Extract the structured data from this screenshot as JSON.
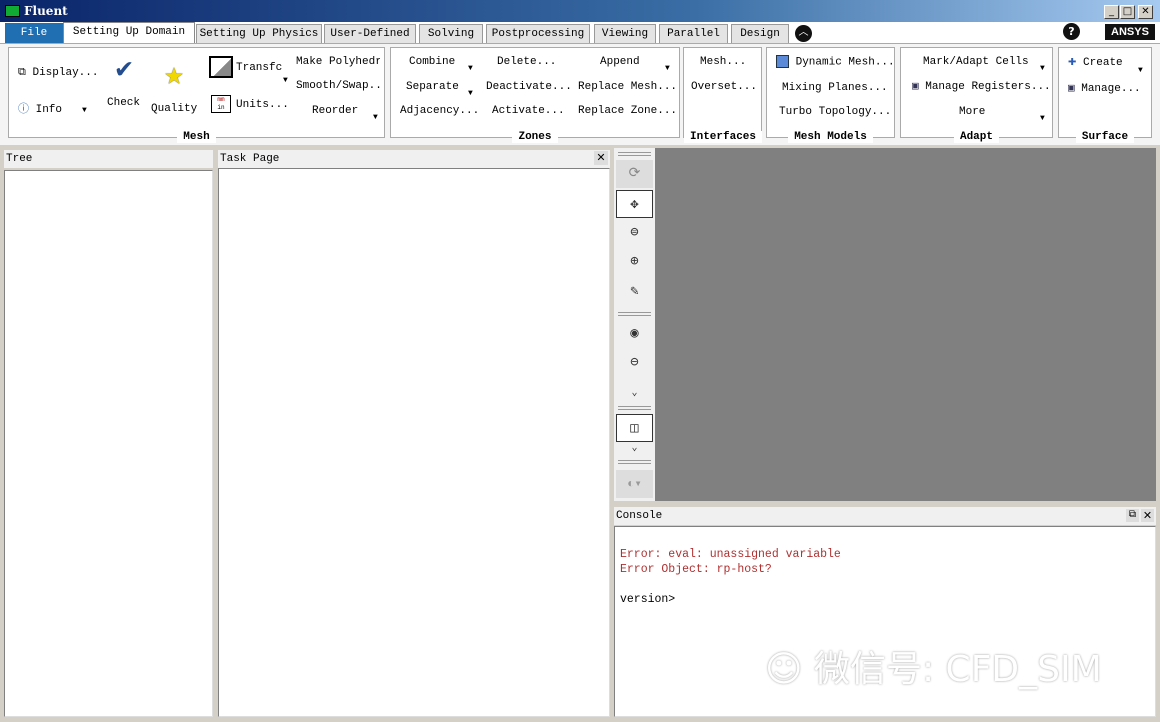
{
  "window": {
    "title": "Fluent",
    "min": "_",
    "max": "□",
    "close": "✕"
  },
  "tabs": [
    "File",
    "Setting Up Domain",
    "Setting Up Physics",
    "User-Defined",
    "Solving",
    "Postprocessing",
    "Viewing",
    "Parallel",
    "Design"
  ],
  "help": "?",
  "logo": "ANSYS",
  "ribbon": {
    "mesh": {
      "label": "Mesh",
      "display": "Display...",
      "info": "Info",
      "check": "Check",
      "quality": "Quality",
      "transform": "Transfc",
      "units": "Units...",
      "make_polyhedra": "Make Polyhedra",
      "smooth_swap": "Smooth/Swap...",
      "reorder": "Reorder",
      "units_icon_top": "mm",
      "units_icon_bottom": "in"
    },
    "zones": {
      "label": "Zones",
      "combine": "Combine",
      "separate": "Separate",
      "adjacency": "Adjacency...",
      "delete": "Delete...",
      "deactivate": "Deactivate...",
      "activate": "Activate...",
      "append": "Append",
      "replace_mesh": "Replace Mesh...",
      "replace_zone": "Replace Zone..."
    },
    "interfaces": {
      "label": "Interfaces",
      "mesh": "Mesh...",
      "overset": "Overset..."
    },
    "mesh_models": {
      "label": "Mesh Models",
      "dynamic_mesh": "Dynamic Mesh...",
      "mixing_planes": "Mixing Planes...",
      "turbo_topology": "Turbo Topology..."
    },
    "adapt": {
      "label": "Adapt",
      "mark_adapt": "Mark/Adapt Cells",
      "manage_registers": "Manage Registers...",
      "more": "More"
    },
    "surface": {
      "label": "Surface",
      "create": "Create",
      "manage": "Manage..."
    }
  },
  "tree": {
    "title": "Tree"
  },
  "task_page": {
    "title": "Task Page"
  },
  "console": {
    "title": "Console",
    "lines": [
      "Error: eval: unassigned variable",
      "Error Object: rp-host?"
    ],
    "prompt": "version>"
  },
  "watermark": "微信号: CFD_SIM"
}
